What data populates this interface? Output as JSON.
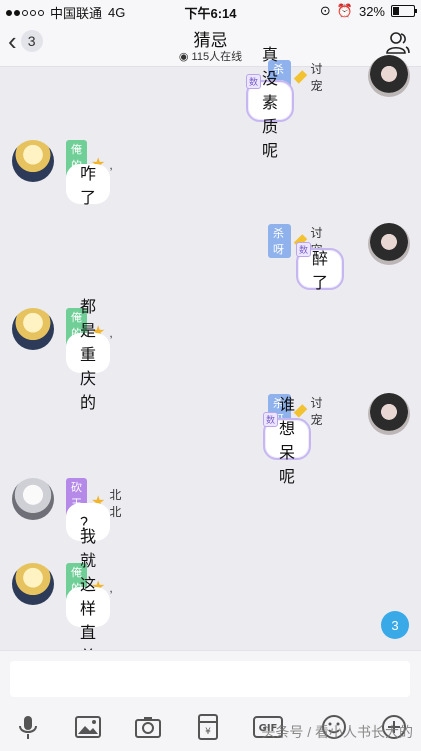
{
  "status_bar": {
    "carrier": "中国联通",
    "network": "4G",
    "time": "下午6:14",
    "battery": "32%",
    "battery_level": 0.32
  },
  "nav": {
    "back_count": "3",
    "title": "猜忌",
    "online": "115人在线"
  },
  "messages": [
    {
      "side": "right",
      "text": "真没素质呢",
      "badge": "数"
    },
    {
      "side": "left",
      "tag": "俺的许",
      "tag_color": "#6fcf97",
      "suffix": ",",
      "text": "咋了"
    },
    {
      "side": "right",
      "tag": "杀呀",
      "tag_color": "#8fb2ec",
      "name": "讨宠",
      "text": "醉了",
      "badge": "数"
    },
    {
      "side": "left",
      "tag": "俺的许",
      "tag_color": "#6fcf97",
      "suffix": ",",
      "text": "都是重庆的"
    },
    {
      "side": "right",
      "tag": "杀呀",
      "tag_color": "#8fb2ec",
      "name": "讨宠",
      "text": "谁想呆呢",
      "badge": "数"
    },
    {
      "side": "left",
      "tag": "砍王北",
      "tag_color": "#b489e8",
      "name": "北北",
      "text": "？"
    },
    {
      "side": "left",
      "tag": "俺的许",
      "tag_color": "#6fcf97",
      "suffix": ",",
      "text": "我就这样直着说"
    }
  ],
  "unread_count": "3",
  "toolbar": [
    "mic-icon",
    "image-icon",
    "camera-icon",
    "red-packet-icon",
    "gif-icon",
    "emoji-icon",
    "add-icon"
  ],
  "watermark": "头条号 / 看小人书长大的"
}
